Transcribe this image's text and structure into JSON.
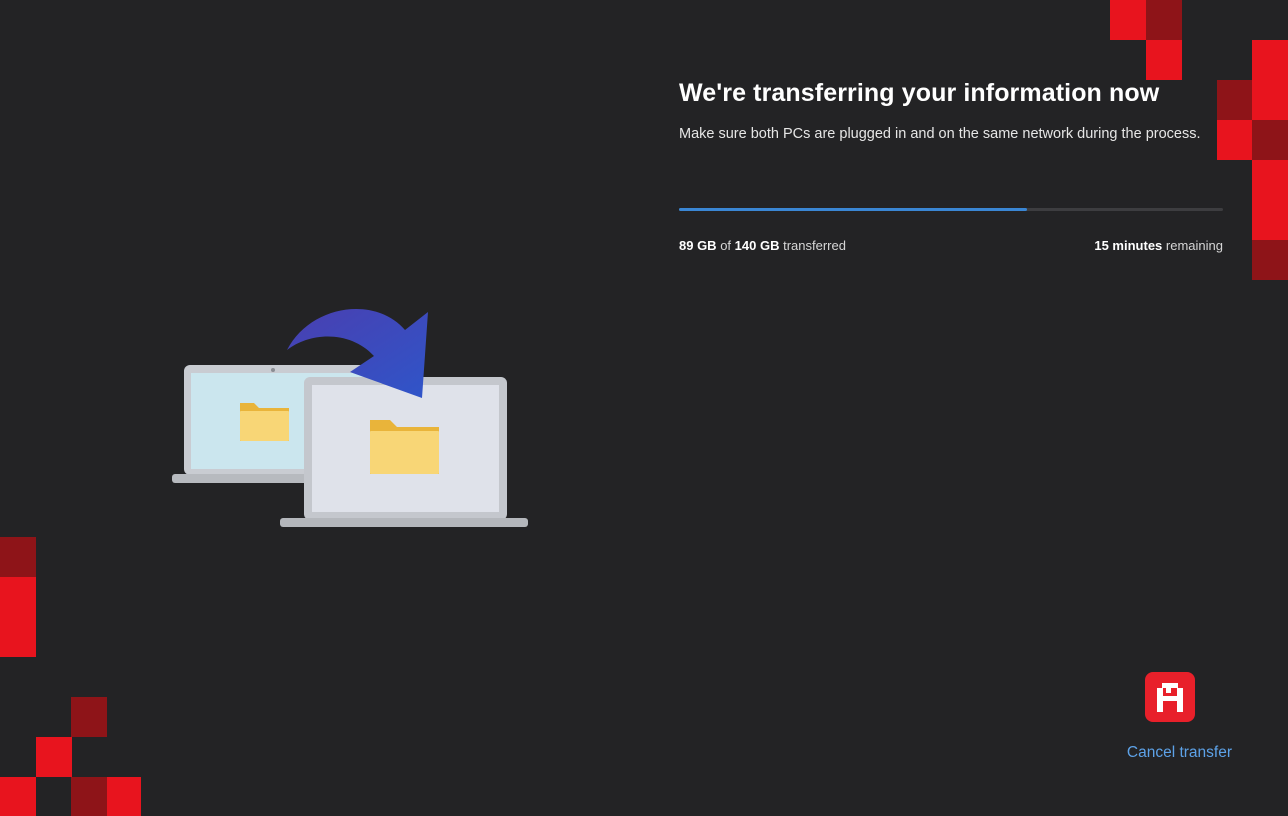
{
  "transfer": {
    "title": "We're transferring your information now",
    "subtitle": "Make sure both PCs are plugged in and on the same network during the process.",
    "transferred_amount": "89 GB",
    "of_text": "of",
    "total_amount": "140 GB",
    "transferred_suffix": "transferred",
    "time_value": "15 minutes",
    "time_suffix": "remaining",
    "progress_fraction": 0.64
  },
  "actions": {
    "cancel_label": "Cancel transfer"
  },
  "colors": {
    "background": "#232325",
    "accent_progress": "#3a86d4",
    "link": "#5da2e8",
    "brand_red": "#e8202a"
  },
  "icons": {
    "illustration": "pc-to-pc-transfer-illustration",
    "brand": "brand-logo-icon"
  }
}
